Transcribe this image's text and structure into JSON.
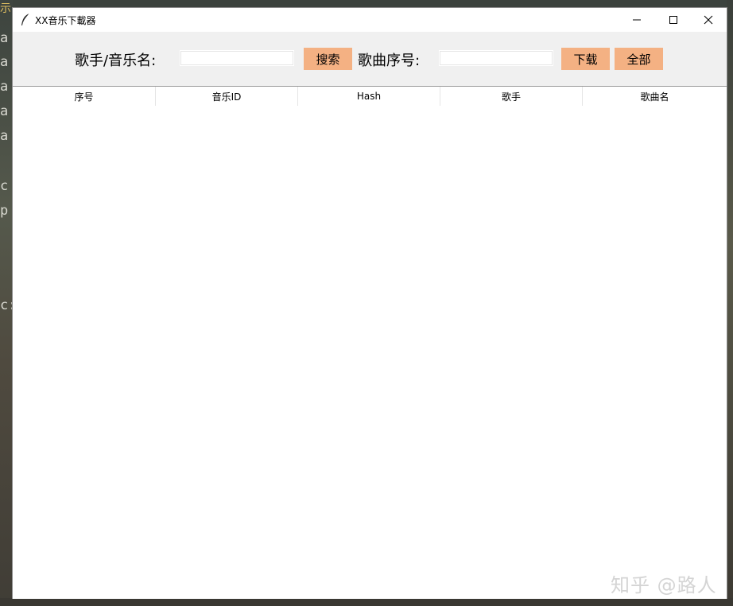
{
  "background": {
    "fragments": [
      "示",
      "a",
      "a",
      "a",
      "a",
      "a",
      "c",
      "p",
      "c:"
    ]
  },
  "window": {
    "title": "XX音乐下載器",
    "app_icon": "feather-icon",
    "controls": {
      "minimize": "minimize-icon",
      "maximize": "maximize-icon",
      "close": "close-icon"
    }
  },
  "toolbar": {
    "singer_label": "歌手/音乐名:",
    "singer_value": "",
    "search_label": "搜索",
    "index_label": "歌曲序号:",
    "index_value": "",
    "download_label": "下载",
    "all_label": "全部",
    "button_color": "#f4b183"
  },
  "table": {
    "columns": [
      "序号",
      "音乐ID",
      "Hash",
      "歌手",
      "歌曲名"
    ],
    "rows": []
  },
  "watermark": "知乎 @路人"
}
